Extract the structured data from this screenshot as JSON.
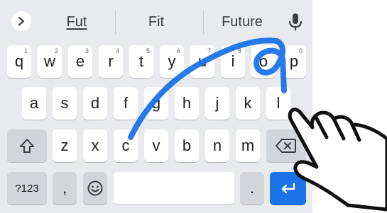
{
  "suggestions": [
    "Fut",
    "Fit",
    "Future"
  ],
  "rows": {
    "row1": [
      {
        "label": "q",
        "hint": "1"
      },
      {
        "label": "w",
        "hint": "2"
      },
      {
        "label": "e",
        "hint": "3"
      },
      {
        "label": "r",
        "hint": "4"
      },
      {
        "label": "t",
        "hint": "5"
      },
      {
        "label": "y",
        "hint": "6"
      },
      {
        "label": "u",
        "hint": "7"
      },
      {
        "label": "i",
        "hint": "8"
      },
      {
        "label": "o",
        "hint": "9"
      },
      {
        "label": "p",
        "hint": "0"
      }
    ],
    "row2": [
      "a",
      "s",
      "d",
      "f",
      "g",
      "h",
      "j",
      "k",
      "l"
    ],
    "row3": [
      "z",
      "x",
      "c",
      "v",
      "b",
      "n",
      "m"
    ]
  },
  "bottom": {
    "symbols_label": "?123",
    "comma_label": ",",
    "period_label": "."
  },
  "icons": {
    "expand": "chevron-right-icon",
    "voice": "microphone-icon",
    "shift": "shift-arrow-icon",
    "delete": "backspace-icon",
    "emoji": "emoji-smile-icon",
    "enter": "enter-arrow-icon",
    "gesture": "pointing-hand-icon"
  },
  "colors": {
    "keyboard_bg": "#e8eaed",
    "key_bg": "#ffffff",
    "function_key_bg": "#d2d5da",
    "enter_key_bg": "#1a73e8",
    "glide_trail": "#1a73e8"
  }
}
